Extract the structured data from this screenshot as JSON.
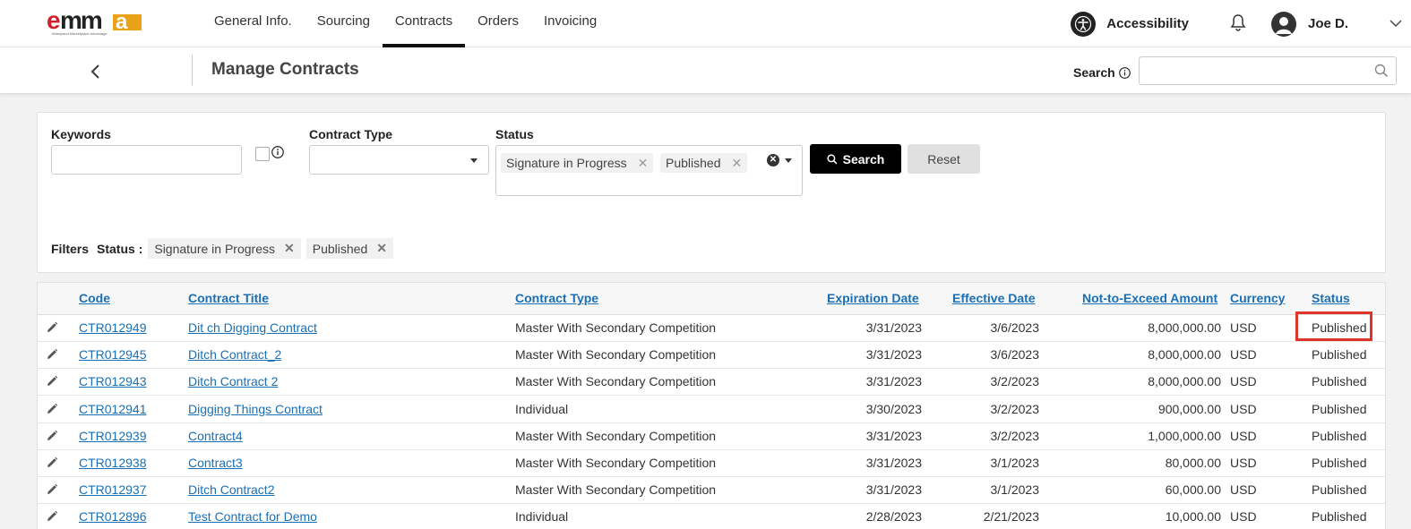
{
  "app": {
    "logo_text": "emma",
    "logo_tagline": "eMaryland Marketplace Advantage"
  },
  "nav": {
    "items": [
      {
        "label": "General Info.",
        "active": false
      },
      {
        "label": "Sourcing",
        "active": false
      },
      {
        "label": "Contracts",
        "active": true
      },
      {
        "label": "Orders",
        "active": false
      },
      {
        "label": "Invoicing",
        "active": false
      }
    ],
    "accessibility_label": "Accessibility",
    "user_name": "Joe D."
  },
  "subheader": {
    "title": "Manage Contracts",
    "search_label": "Search",
    "search_placeholder": ""
  },
  "filters": {
    "keywords_label": "Keywords",
    "keywords_value": "",
    "contract_type_label": "Contract Type",
    "contract_type_value": "",
    "status_label": "Status",
    "status_selected": [
      "Signature in Progress",
      "Published"
    ],
    "search_button": "Search",
    "reset_button": "Reset",
    "applied_label": "Filters",
    "applied_status_label": "Status :",
    "applied_chips": [
      "Signature in Progress",
      "Published"
    ]
  },
  "table": {
    "columns": [
      "Code",
      "Contract Title",
      "Contract Type",
      "Expiration Date",
      "Effective Date",
      "Not-to-Exceed Amount",
      "Currency",
      "Status"
    ],
    "rows": [
      {
        "code": "CTR012949",
        "title": "Dit ch Digging Contract",
        "type": "Master With Secondary Competition",
        "expiration": "3/31/2023",
        "effective": "3/6/2023",
        "amount": "8,000,000.00",
        "currency": "USD",
        "status": "Published"
      },
      {
        "code": "CTR012945",
        "title": "Ditch Contract_2",
        "type": "Master With Secondary Competition",
        "expiration": "3/31/2023",
        "effective": "3/6/2023",
        "amount": "8,000,000.00",
        "currency": "USD",
        "status": "Published"
      },
      {
        "code": "CTR012943",
        "title": "Ditch Contract 2",
        "type": "Master With Secondary Competition",
        "expiration": "3/31/2023",
        "effective": "3/2/2023",
        "amount": "8,000,000.00",
        "currency": "USD",
        "status": "Published"
      },
      {
        "code": "CTR012941",
        "title": "Digging Things Contract",
        "type": "Individual",
        "expiration": "3/30/2023",
        "effective": "3/2/2023",
        "amount": "900,000.00",
        "currency": "USD",
        "status": "Published"
      },
      {
        "code": "CTR012939",
        "title": "Contract4",
        "type": "Master With Secondary Competition",
        "expiration": "3/31/2023",
        "effective": "3/2/2023",
        "amount": "1,000,000.00",
        "currency": "USD",
        "status": "Published"
      },
      {
        "code": "CTR012938",
        "title": "Contract3",
        "type": "Master With Secondary Competition",
        "expiration": "3/31/2023",
        "effective": "3/1/2023",
        "amount": "80,000.00",
        "currency": "USD",
        "status": "Published"
      },
      {
        "code": "CTR012937",
        "title": "Ditch Contract2",
        "type": "Master With Secondary Competition",
        "expiration": "3/31/2023",
        "effective": "3/1/2023",
        "amount": "60,000.00",
        "currency": "USD",
        "status": "Published"
      },
      {
        "code": "CTR012896",
        "title": "Test Contract for Demo",
        "type": "Individual",
        "expiration": "2/28/2023",
        "effective": "2/21/2023",
        "amount": "10,000.00",
        "currency": "USD",
        "status": "Published"
      }
    ]
  },
  "colors": {
    "link": "#1a6fb5",
    "highlight": "#e0342a",
    "logo_red": "#d0222b",
    "logo_gold": "#e8a21a"
  }
}
